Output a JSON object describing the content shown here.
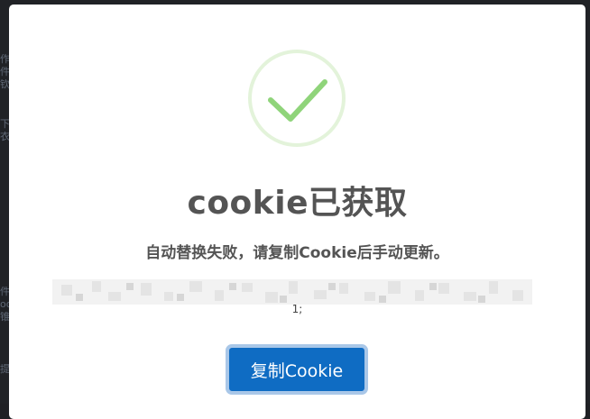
{
  "background": {
    "lines": [
      "作",
      "件",
      "钦",
      "下",
      "衣",
      "件",
      "oo",
      "锥",
      "提"
    ]
  },
  "dialog": {
    "icon": "checkmark-success-icon",
    "title": "cookie已获取",
    "message": "自动替换失败，请复制Cookie后手动更新。",
    "cookie_tail": "1;",
    "copy_button_label": "复制Cookie"
  },
  "colors": {
    "success_ring": "#e3f3da",
    "success_check": "#8fd47a",
    "text": "#545454",
    "button": "#0f6cc3",
    "button_focus_ring": "#a9c7e8",
    "backdrop": "#202226"
  }
}
